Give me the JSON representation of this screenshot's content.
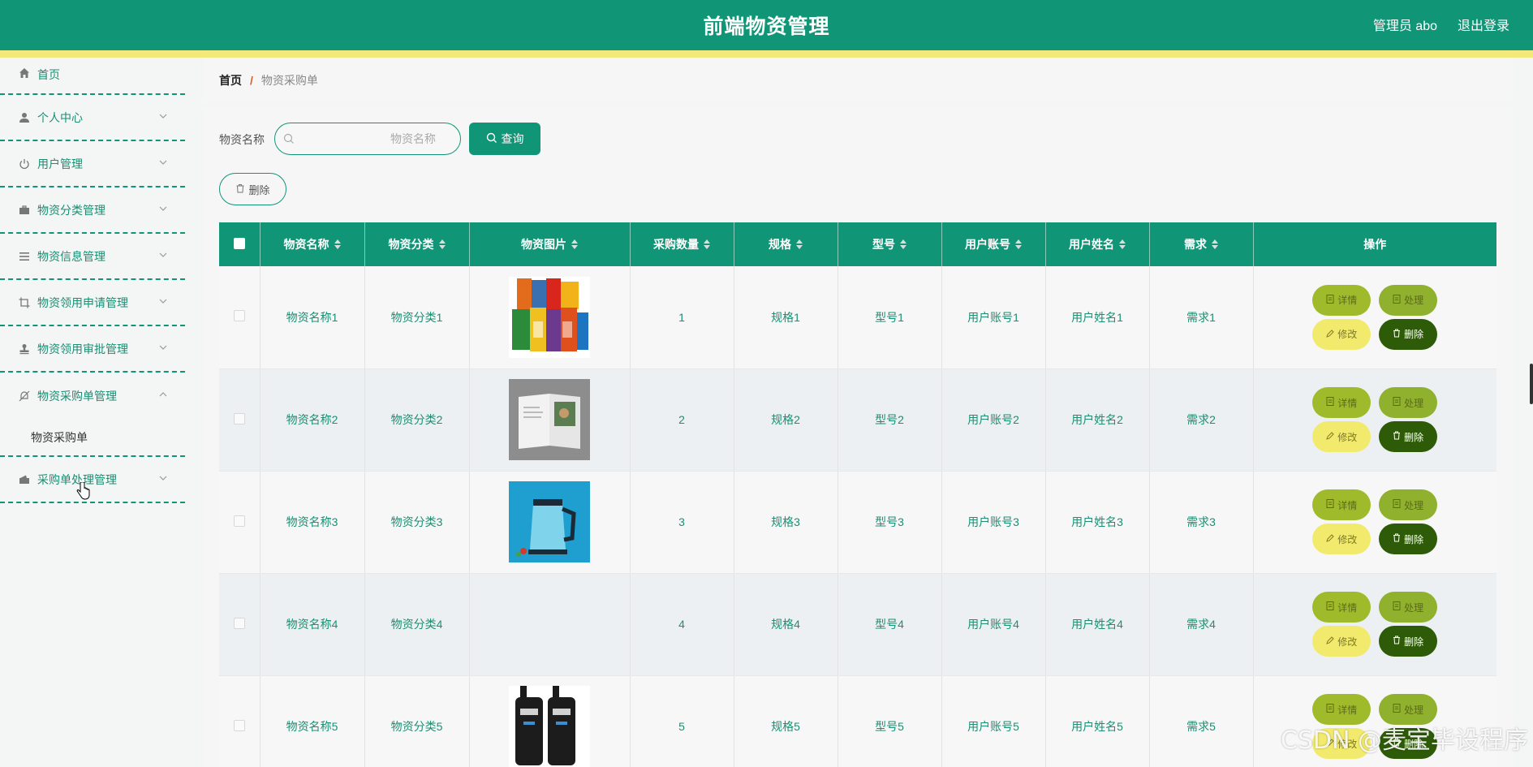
{
  "header": {
    "title": "前端物资管理",
    "user": "管理员 abo",
    "logout": "退出登录",
    "colors": {
      "primary": "#109576",
      "stripe": "#f3e97a"
    }
  },
  "sidebar": {
    "items": [
      {
        "label": "首页",
        "icon": "home-icon"
      },
      {
        "label": "个人中心",
        "icon": "user-icon"
      },
      {
        "label": "用户管理",
        "icon": "power-icon"
      },
      {
        "label": "物资分类管理",
        "icon": "briefcase-icon"
      },
      {
        "label": "物资信息管理",
        "icon": "list-icon"
      },
      {
        "label": "物资领用申请管理",
        "icon": "crop-icon"
      },
      {
        "label": "物资领用审批管理",
        "icon": "stamp-icon"
      },
      {
        "label": "物资采购单管理",
        "icon": "bell-off-icon",
        "expanded": true,
        "children": [
          "物资采购单"
        ]
      },
      {
        "label": "采购单处理管理",
        "icon": "wallet-icon"
      }
    ]
  },
  "breadcrumb": {
    "home": "首页",
    "separator": "/",
    "current": "物资采购单"
  },
  "search": {
    "label": "物资名称",
    "placeholder": "物资名称",
    "button": "查询"
  },
  "batch_delete": "删除",
  "table": {
    "columns": [
      "物资名称",
      "物资分类",
      "物资图片",
      "采购数量",
      "规格",
      "型号",
      "用户账号",
      "用户姓名",
      "需求",
      "操作"
    ],
    "rows": [
      {
        "name": "物资名称1",
        "category": "物资分类1",
        "image": "snacks",
        "qty": "1",
        "spec": "规格1",
        "model": "型号1",
        "account": "用户账号1",
        "username": "用户姓名1",
        "need": "需求1"
      },
      {
        "name": "物资名称2",
        "category": "物资分类2",
        "image": "book",
        "qty": "2",
        "spec": "规格2",
        "model": "型号2",
        "account": "用户账号2",
        "username": "用户姓名2",
        "need": "需求2"
      },
      {
        "name": "物资名称3",
        "category": "物资分类3",
        "image": "kettle",
        "qty": "3",
        "spec": "规格3",
        "model": "型号3",
        "account": "用户账号3",
        "username": "用户姓名3",
        "need": "需求3"
      },
      {
        "name": "物资名称4",
        "category": "物资分类4",
        "image": "",
        "qty": "4",
        "spec": "规格4",
        "model": "型号4",
        "account": "用户账号4",
        "username": "用户姓名4",
        "need": "需求4"
      },
      {
        "name": "物资名称5",
        "category": "物资分类5",
        "image": "bottles",
        "qty": "5",
        "spec": "规格5",
        "model": "型号5",
        "account": "用户账号5",
        "username": "用户姓名5",
        "need": "需求5"
      }
    ],
    "actions": {
      "detail": "详情",
      "handle": "处理",
      "edit": "修改",
      "delete": "删除"
    }
  },
  "watermark": "CSDN @麦宝毕设程序"
}
